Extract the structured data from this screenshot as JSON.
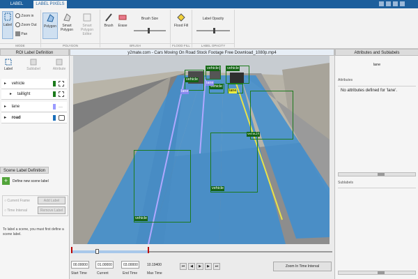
{
  "tabs": [
    {
      "label": "LABEL"
    },
    {
      "label": "LABEL PIXELS"
    }
  ],
  "ribbon": {
    "label_btn": "Label",
    "zoom_in": "Zoom in",
    "zoom_out": "Zoom Out",
    "pan": "Pan",
    "mode_section": "MODE",
    "polygon": "Polygon",
    "smart_polygon": "Smart Polygon",
    "smart_polygon_editor": "Smart Polygon Editor",
    "polygon_section": "POLYGON",
    "brush": "Brush",
    "erase": "Erase",
    "brush_size": "Brush Size",
    "brush_section": "BRUSH",
    "flood_fill": "Flood Fill",
    "flood_section": "FLOOD FILL",
    "label_opacity": "Label Opacity",
    "opacity_section": "LABEL OPACITY"
  },
  "left": {
    "title": "ROI Label Definition",
    "tools": [
      "Label",
      "Sublabel",
      "Attribute"
    ],
    "labels": [
      {
        "name": "vehicle",
        "color": "#1b7a1b"
      },
      {
        "name": "taillight",
        "color": "#1b7a1b"
      },
      {
        "name": "lane",
        "color": "#9b9bff"
      },
      {
        "name": "road",
        "color": "#1a6fba"
      }
    ],
    "scene_title": "Scene Label Definition",
    "define_scene": "Define new scene label",
    "current_frame": "Current Frame",
    "time_interval": "Time Interval",
    "add_label": "Add Label",
    "remove_label": "Remove Label",
    "help_text": "To label a scene, you must first define a scene label."
  },
  "video": {
    "title": "y2mate.com - Cars Moving On Road Stock Footage  Free Download_1080p.mp4",
    "boxes": [
      "vehicle",
      "vehicle",
      "vehicle",
      "vehicle",
      "vehicle",
      "vehicle",
      "vehicle",
      "vehicle"
    ],
    "lane_tags": [
      "lane",
      "lane",
      "lane"
    ],
    "start_time": "00.00000",
    "current": "01.00000",
    "end_time": "03.00000",
    "max_time": "10.19400",
    "start_label": "Start Time",
    "current_label": "Current",
    "end_label": "End Time",
    "max_label": "Max Time",
    "zoom_interval": "Zoom In Time Interval"
  },
  "right": {
    "title": "Attributes and Sublabels",
    "selected": "lane",
    "attributes_header": "Attributes",
    "no_attr": "No attributes defined for 'lane'.",
    "sublabels_header": "Sublabels"
  }
}
